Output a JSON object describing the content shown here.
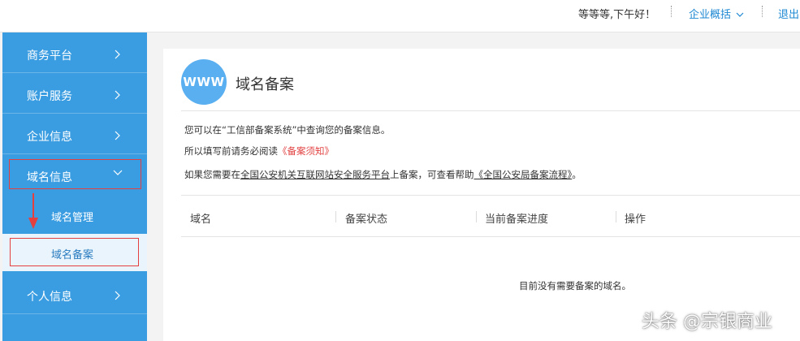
{
  "header": {
    "greeting": "等等等,下午好！",
    "overview_label": "企业概括",
    "logout_label": "退出"
  },
  "sidebar": {
    "items": [
      {
        "label": "商务平台",
        "icon": "chevron-right-icon"
      },
      {
        "label": "账户服务",
        "icon": "chevron-right-icon"
      },
      {
        "label": "企业信息",
        "icon": "chevron-right-icon"
      },
      {
        "label": "域名信息",
        "icon": "chevron-down-icon"
      },
      {
        "label": "个人信息",
        "icon": "chevron-right-icon"
      }
    ],
    "sub_items": [
      {
        "label": "域名管理"
      },
      {
        "label": "域名备案"
      }
    ],
    "highlight_color": "#e44040"
  },
  "main": {
    "badge_text": "WWW",
    "title": "域名备案",
    "line1": "您可以在“工信部备案系统”中查询您的备案信息。",
    "line2_prefix": "所以填写前请务必阅读",
    "line2_link": "《备案须知》",
    "line3_prefix": "如果您需要在",
    "line3_link1": "全国公安机关互联网站安全服务平台",
    "line3_middle": "上备案，可查看帮助",
    "line3_link2": "《全国公安局备案流程》",
    "line3_suffix": "。",
    "table": {
      "columns": [
        "域名",
        "备案状态",
        "当前备案进度",
        "操作"
      ],
      "empty_text": "目前没有需要备案的域名。"
    }
  },
  "watermark": "头条 @宗银商业",
  "colors": {
    "sidebar_bg": "#3b9de1",
    "badge_bg": "#5aaff0",
    "link_blue": "#1e88d3",
    "link_red": "#e24242"
  }
}
